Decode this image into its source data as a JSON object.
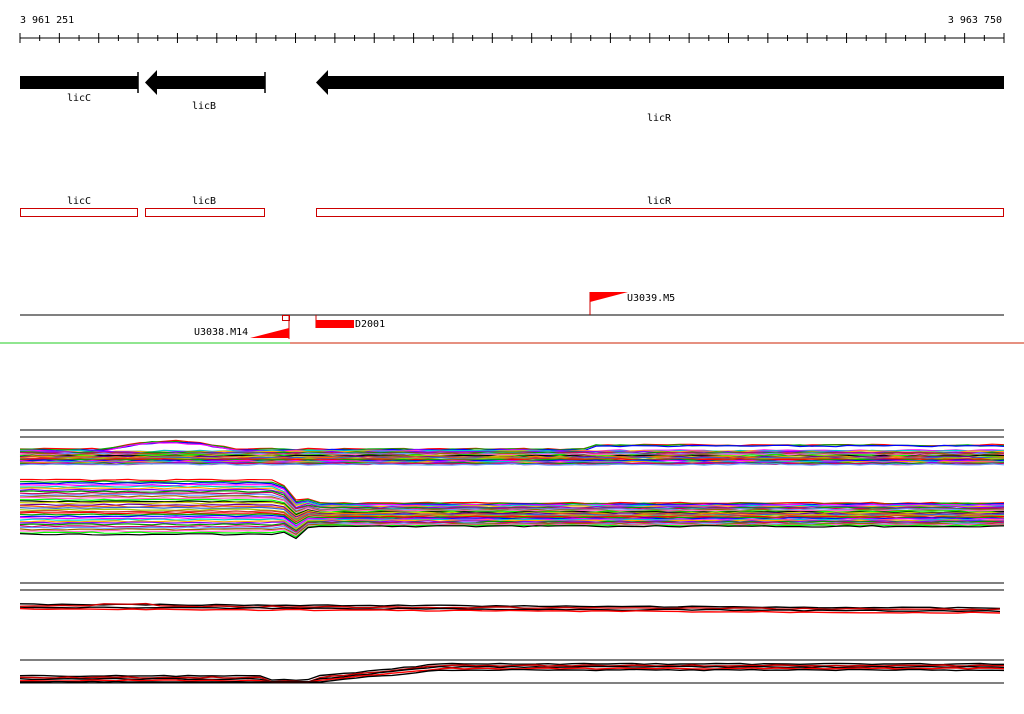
{
  "ruler": {
    "start_label": "3 961 251",
    "end_label": "3 963 750"
  },
  "genes": [
    {
      "name": "licC",
      "direction": "forward"
    },
    {
      "name": "licB",
      "direction": "reverse"
    },
    {
      "name": "licR",
      "direction": "reverse"
    }
  ],
  "cds": [
    {
      "name": "licC"
    },
    {
      "name": "licB"
    },
    {
      "name": "licR"
    }
  ],
  "features": {
    "marker_u3038": "U3038.M14",
    "marker_u3039": "U3039.M5",
    "marker_d2001": "D2001"
  },
  "colors": {
    "gene": "#000000",
    "cds_outline": "#cc0000",
    "feature": "#ff0000",
    "divider_red": "#cc2200",
    "divider_green": "#22cc22"
  }
}
